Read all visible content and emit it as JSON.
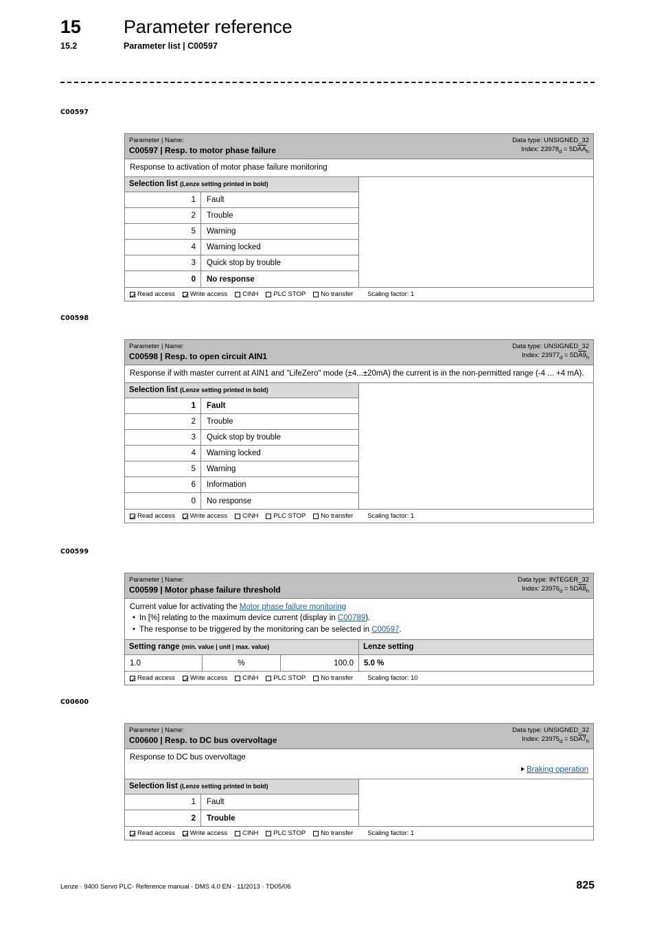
{
  "header": {
    "chapter_number": "15",
    "chapter_title": "Parameter reference",
    "section_number": "15.2",
    "section_title": "Parameter list | C00597"
  },
  "footer": {
    "text": "Lenze · 9400 Servo PLC· Reference manual · DMS 4.0 EN · 11/2013 · TD05/06",
    "page_number": "825"
  },
  "labels": {
    "param_name_kicker": "Parameter | Name:",
    "selection_list_title": "Selection list",
    "selection_list_note": "(Lenze setting printed in bold)",
    "setting_range_title": "Setting range",
    "setting_range_note": "(min. value | unit | max. value)",
    "lenze_setting_title": "Lenze setting",
    "read_access": "Read access",
    "write_access": "Write access",
    "cinh": "CINH",
    "plc_stop": "PLC STOP",
    "no_transfer": "No transfer"
  },
  "blocks": [
    {
      "margin_tag": "C00597",
      "title": "C00597 | Resp. to motor phase failure",
      "data_type": "Data type: UNSIGNED_32",
      "index_prefix": "Index: 23978",
      "index_sub_dec": "d",
      "index_eq": " = 5D",
      "index_hex_overline": "AA",
      "index_sub_hex": "h",
      "description": "Response to activation of motor phase failure monitoring",
      "selection_list": [
        {
          "code": "1",
          "label": "Fault",
          "bold": false
        },
        {
          "code": "2",
          "label": "Trouble",
          "bold": false
        },
        {
          "code": "5",
          "label": "Warning",
          "bold": false
        },
        {
          "code": "4",
          "label": "Warning locked",
          "bold": false
        },
        {
          "code": "3",
          "label": "Quick stop by trouble",
          "bold": false
        },
        {
          "code": "0",
          "label": "No response",
          "bold": true
        }
      ],
      "scaling_factor": "Scaling factor: 1"
    },
    {
      "margin_tag": "C00598",
      "title": "C00598 | Resp. to open circuit AIN1",
      "data_type": "Data type: UNSIGNED_32",
      "index_prefix": "Index: 23977",
      "index_sub_dec": "d",
      "index_eq": " = 5D",
      "index_hex_overline": "A9",
      "index_sub_hex": "h",
      "description": "Response if with master current at AIN1 and \"LifeZero\" mode (±4...±20mA) the current is in the non-permitted range (-4 ... +4 mA).",
      "selection_list": [
        {
          "code": "1",
          "label": "Fault",
          "bold": true
        },
        {
          "code": "2",
          "label": "Trouble",
          "bold": false
        },
        {
          "code": "3",
          "label": "Quick stop by trouble",
          "bold": false
        },
        {
          "code": "4",
          "label": "Warning locked",
          "bold": false
        },
        {
          "code": "5",
          "label": "Warning",
          "bold": false
        },
        {
          "code": "6",
          "label": "Information",
          "bold": false
        },
        {
          "code": "0",
          "label": "No response",
          "bold": false
        }
      ],
      "scaling_factor": "Scaling factor: 1"
    },
    {
      "margin_tag": "C00599",
      "title": "C00599 | Motor phase failure threshold",
      "data_type": "Data type: INTEGER_32",
      "index_prefix": "Index: 23976",
      "index_sub_dec": "d",
      "index_eq": " = 5D",
      "index_hex_overline": "A8",
      "index_sub_hex": "h",
      "description_intro": "Current value for activating the ",
      "description_intro_link": "Motor phase failure monitoring",
      "bullets": [
        {
          "pre": "In [%] relating to the maximum device current (display in ",
          "link": "C00789",
          "post": ")."
        },
        {
          "pre": "The response to be triggered by the monitoring can be selected in ",
          "link": "C00597",
          "post": "."
        }
      ],
      "setting_range": {
        "min": "1.0",
        "unit": "%",
        "max": "100.0",
        "lenze_setting": "5.0 %"
      },
      "scaling_factor": "Scaling factor: 10"
    },
    {
      "margin_tag": "C00600",
      "title": "C00600 | Resp. to DC bus overvoltage",
      "data_type": "Data type: UNSIGNED_32",
      "index_prefix": "Index: 23975",
      "index_sub_dec": "d",
      "index_eq": " = 5D",
      "index_hex_overline": "A7",
      "index_sub_hex": "h",
      "description": "Response to DC bus overvoltage",
      "see_also_link": "Braking operation",
      "selection_list": [
        {
          "code": "1",
          "label": "Fault",
          "bold": false
        },
        {
          "code": "2",
          "label": "Trouble",
          "bold": true
        }
      ],
      "scaling_factor": "Scaling factor: 1"
    }
  ]
}
